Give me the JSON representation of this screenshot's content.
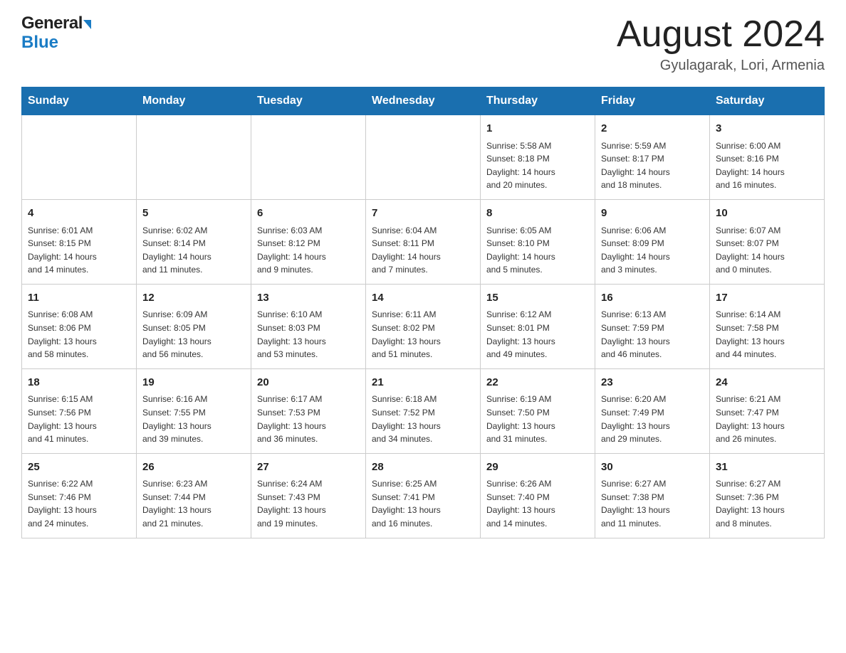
{
  "header": {
    "logo_general": "General",
    "logo_blue": "Blue",
    "month_title": "August 2024",
    "location": "Gyulagarak, Lori, Armenia"
  },
  "weekdays": [
    "Sunday",
    "Monday",
    "Tuesday",
    "Wednesday",
    "Thursday",
    "Friday",
    "Saturday"
  ],
  "weeks": [
    [
      {
        "day": "",
        "info": ""
      },
      {
        "day": "",
        "info": ""
      },
      {
        "day": "",
        "info": ""
      },
      {
        "day": "",
        "info": ""
      },
      {
        "day": "1",
        "info": "Sunrise: 5:58 AM\nSunset: 8:18 PM\nDaylight: 14 hours\nand 20 minutes."
      },
      {
        "day": "2",
        "info": "Sunrise: 5:59 AM\nSunset: 8:17 PM\nDaylight: 14 hours\nand 18 minutes."
      },
      {
        "day": "3",
        "info": "Sunrise: 6:00 AM\nSunset: 8:16 PM\nDaylight: 14 hours\nand 16 minutes."
      }
    ],
    [
      {
        "day": "4",
        "info": "Sunrise: 6:01 AM\nSunset: 8:15 PM\nDaylight: 14 hours\nand 14 minutes."
      },
      {
        "day": "5",
        "info": "Sunrise: 6:02 AM\nSunset: 8:14 PM\nDaylight: 14 hours\nand 11 minutes."
      },
      {
        "day": "6",
        "info": "Sunrise: 6:03 AM\nSunset: 8:12 PM\nDaylight: 14 hours\nand 9 minutes."
      },
      {
        "day": "7",
        "info": "Sunrise: 6:04 AM\nSunset: 8:11 PM\nDaylight: 14 hours\nand 7 minutes."
      },
      {
        "day": "8",
        "info": "Sunrise: 6:05 AM\nSunset: 8:10 PM\nDaylight: 14 hours\nand 5 minutes."
      },
      {
        "day": "9",
        "info": "Sunrise: 6:06 AM\nSunset: 8:09 PM\nDaylight: 14 hours\nand 3 minutes."
      },
      {
        "day": "10",
        "info": "Sunrise: 6:07 AM\nSunset: 8:07 PM\nDaylight: 14 hours\nand 0 minutes."
      }
    ],
    [
      {
        "day": "11",
        "info": "Sunrise: 6:08 AM\nSunset: 8:06 PM\nDaylight: 13 hours\nand 58 minutes."
      },
      {
        "day": "12",
        "info": "Sunrise: 6:09 AM\nSunset: 8:05 PM\nDaylight: 13 hours\nand 56 minutes."
      },
      {
        "day": "13",
        "info": "Sunrise: 6:10 AM\nSunset: 8:03 PM\nDaylight: 13 hours\nand 53 minutes."
      },
      {
        "day": "14",
        "info": "Sunrise: 6:11 AM\nSunset: 8:02 PM\nDaylight: 13 hours\nand 51 minutes."
      },
      {
        "day": "15",
        "info": "Sunrise: 6:12 AM\nSunset: 8:01 PM\nDaylight: 13 hours\nand 49 minutes."
      },
      {
        "day": "16",
        "info": "Sunrise: 6:13 AM\nSunset: 7:59 PM\nDaylight: 13 hours\nand 46 minutes."
      },
      {
        "day": "17",
        "info": "Sunrise: 6:14 AM\nSunset: 7:58 PM\nDaylight: 13 hours\nand 44 minutes."
      }
    ],
    [
      {
        "day": "18",
        "info": "Sunrise: 6:15 AM\nSunset: 7:56 PM\nDaylight: 13 hours\nand 41 minutes."
      },
      {
        "day": "19",
        "info": "Sunrise: 6:16 AM\nSunset: 7:55 PM\nDaylight: 13 hours\nand 39 minutes."
      },
      {
        "day": "20",
        "info": "Sunrise: 6:17 AM\nSunset: 7:53 PM\nDaylight: 13 hours\nand 36 minutes."
      },
      {
        "day": "21",
        "info": "Sunrise: 6:18 AM\nSunset: 7:52 PM\nDaylight: 13 hours\nand 34 minutes."
      },
      {
        "day": "22",
        "info": "Sunrise: 6:19 AM\nSunset: 7:50 PM\nDaylight: 13 hours\nand 31 minutes."
      },
      {
        "day": "23",
        "info": "Sunrise: 6:20 AM\nSunset: 7:49 PM\nDaylight: 13 hours\nand 29 minutes."
      },
      {
        "day": "24",
        "info": "Sunrise: 6:21 AM\nSunset: 7:47 PM\nDaylight: 13 hours\nand 26 minutes."
      }
    ],
    [
      {
        "day": "25",
        "info": "Sunrise: 6:22 AM\nSunset: 7:46 PM\nDaylight: 13 hours\nand 24 minutes."
      },
      {
        "day": "26",
        "info": "Sunrise: 6:23 AM\nSunset: 7:44 PM\nDaylight: 13 hours\nand 21 minutes."
      },
      {
        "day": "27",
        "info": "Sunrise: 6:24 AM\nSunset: 7:43 PM\nDaylight: 13 hours\nand 19 minutes."
      },
      {
        "day": "28",
        "info": "Sunrise: 6:25 AM\nSunset: 7:41 PM\nDaylight: 13 hours\nand 16 minutes."
      },
      {
        "day": "29",
        "info": "Sunrise: 6:26 AM\nSunset: 7:40 PM\nDaylight: 13 hours\nand 14 minutes."
      },
      {
        "day": "30",
        "info": "Sunrise: 6:27 AM\nSunset: 7:38 PM\nDaylight: 13 hours\nand 11 minutes."
      },
      {
        "day": "31",
        "info": "Sunrise: 6:27 AM\nSunset: 7:36 PM\nDaylight: 13 hours\nand 8 minutes."
      }
    ]
  ]
}
